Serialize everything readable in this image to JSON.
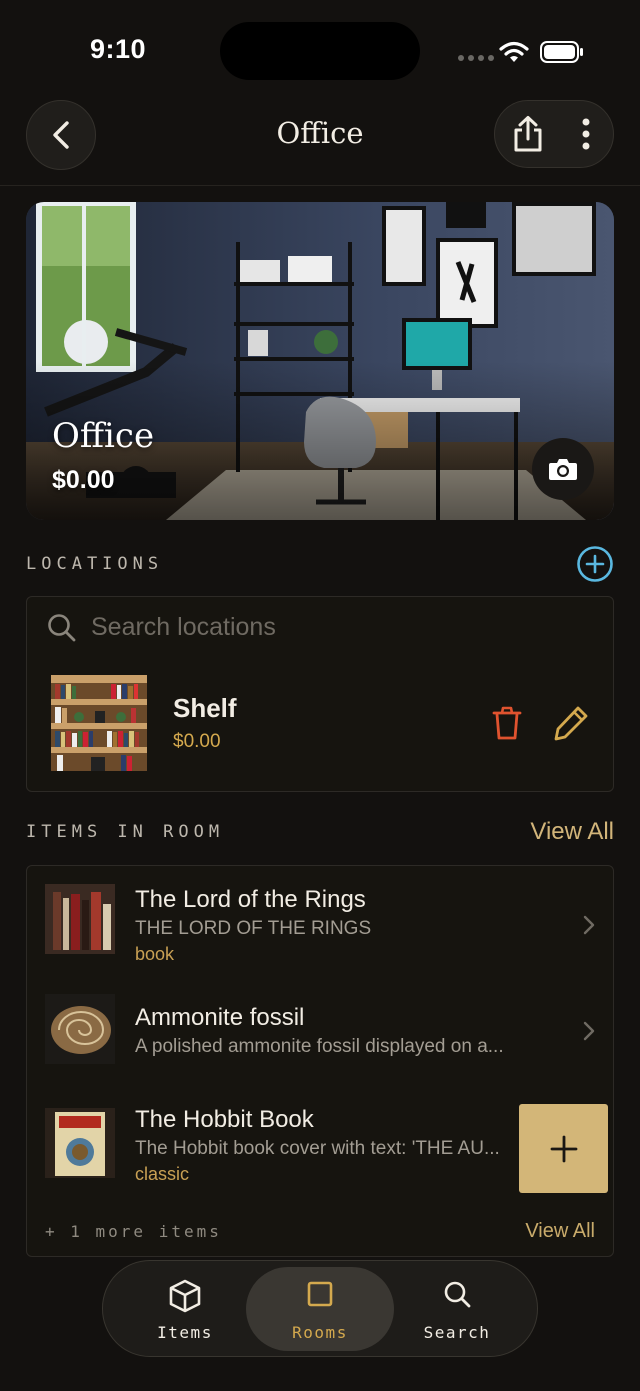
{
  "status_bar": {
    "time": "9:10"
  },
  "header": {
    "title": "Office"
  },
  "hero": {
    "title": "Office",
    "value": "$0.00"
  },
  "locations": {
    "section_label": "LOCATIONS",
    "search_placeholder": "Search locations",
    "items": [
      {
        "name": "Shelf",
        "value": "$0.00"
      }
    ]
  },
  "items_section": {
    "section_label": "ITEMS IN ROOM",
    "view_all_label": "View All",
    "items": [
      {
        "title": "The Lord of the Rings",
        "subtitle": "THE LORD OF THE RINGS",
        "tag": "book"
      },
      {
        "title": "Ammonite fossil",
        "subtitle": "A polished ammonite fossil displayed on a...",
        "tag": ""
      },
      {
        "title": "The Hobbit Book",
        "subtitle": "The Hobbit book cover with text: 'THE AU...",
        "tag": "classic"
      }
    ],
    "more_items_label": "+ 1 more items",
    "bottom_view_all_label": "View All"
  },
  "tab_bar": {
    "tabs": [
      {
        "label": "Items",
        "icon": "cube-icon",
        "active": false
      },
      {
        "label": "Rooms",
        "icon": "square-icon",
        "active": true
      },
      {
        "label": "Search",
        "icon": "search-icon",
        "active": false
      }
    ]
  },
  "colors": {
    "background": "#13110f",
    "accent_gold": "#d4a94e",
    "fab": "#d3b678",
    "delete_red": "#e0532f",
    "add_blue": "#5ab8e0"
  }
}
